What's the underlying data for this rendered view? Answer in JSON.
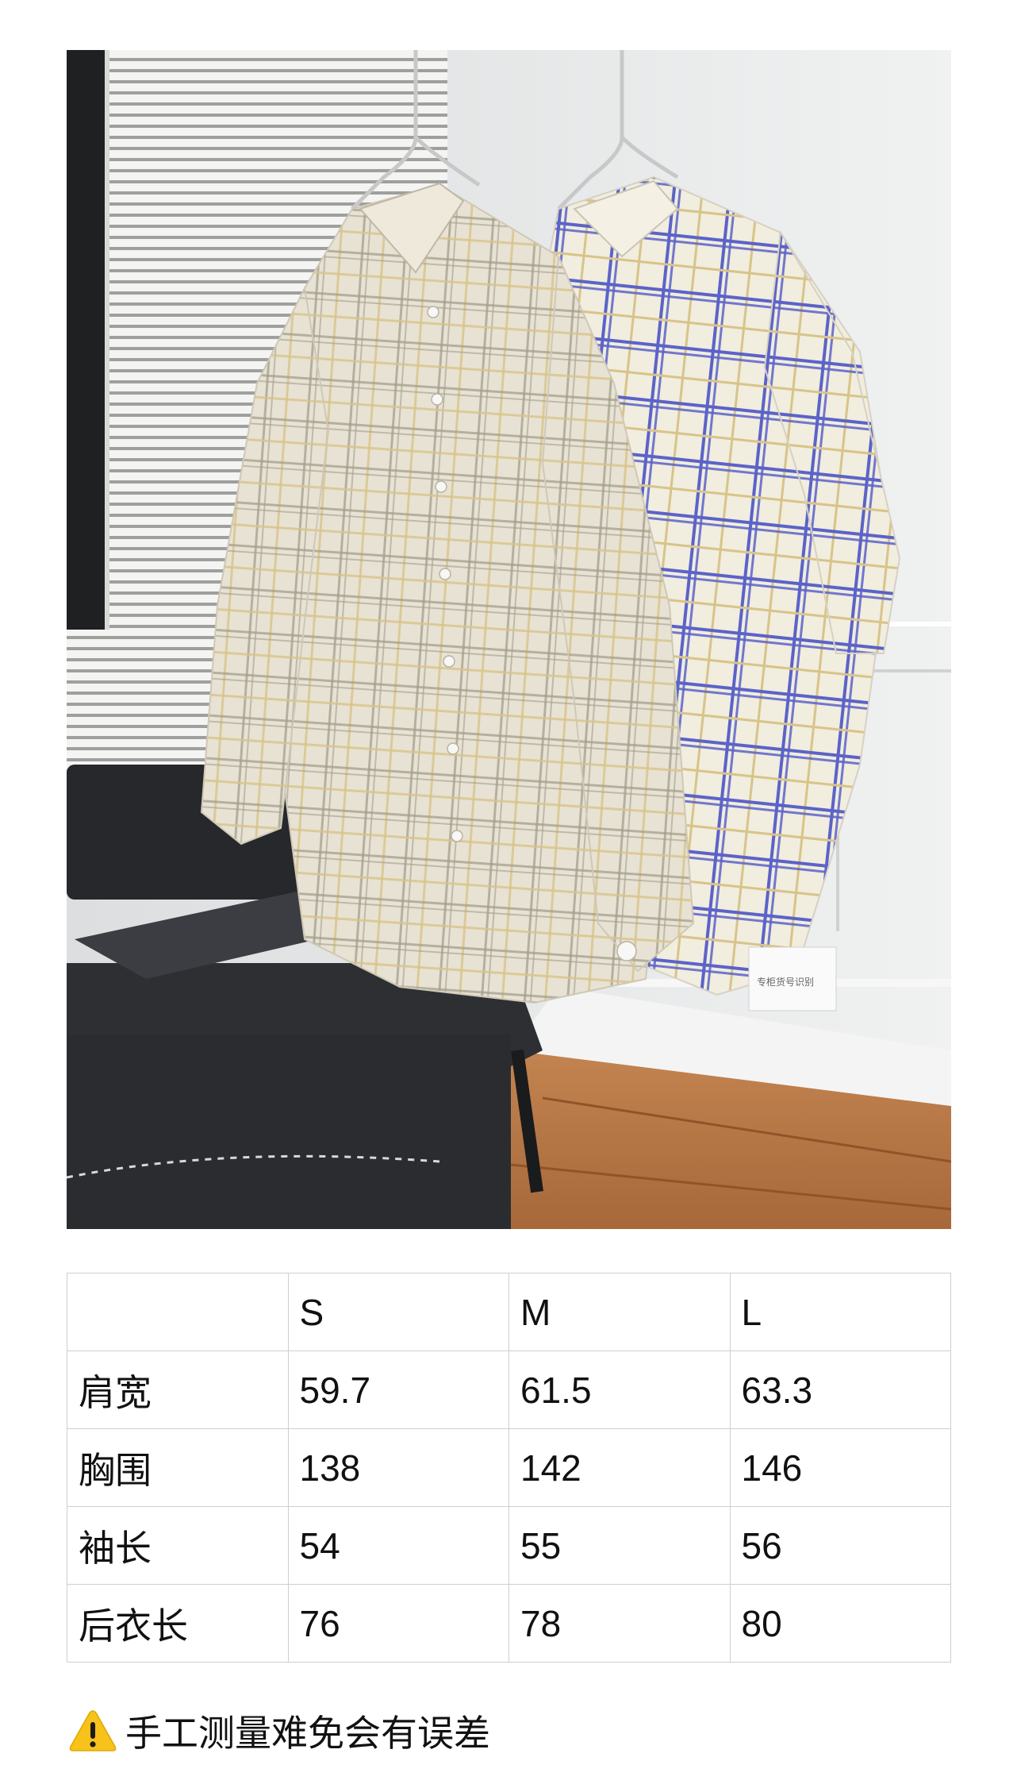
{
  "photo": {
    "tag_text": "专柜货号识别",
    "colors": {
      "wall": "#e9eaea",
      "floor": "#b3733e",
      "sofa": "#2d2f33",
      "shirt_left_base": "#e8e2d4",
      "shirt_left_check": "#a39e8c",
      "shirt_left_check_accent": "#d8c489",
      "shirt_right_base": "#f1eddf",
      "shirt_right_check": "#5b63c8",
      "shirt_right_check_accent": "#d8c489"
    }
  },
  "size_table": {
    "header": [
      "",
      "S",
      "M",
      "L"
    ],
    "rows": [
      {
        "label": "肩宽",
        "values": [
          "59.7",
          "61.5",
          "63.3"
        ]
      },
      {
        "label": "胸围",
        "values": [
          "138",
          "142",
          "146"
        ]
      },
      {
        "label": "袖长",
        "values": [
          "54",
          "55",
          "56"
        ]
      },
      {
        "label": "后衣长",
        "values": [
          "76",
          "78",
          "80"
        ]
      }
    ]
  },
  "note": {
    "icon": "warning-icon",
    "text": "手工测量难免会有误差"
  }
}
